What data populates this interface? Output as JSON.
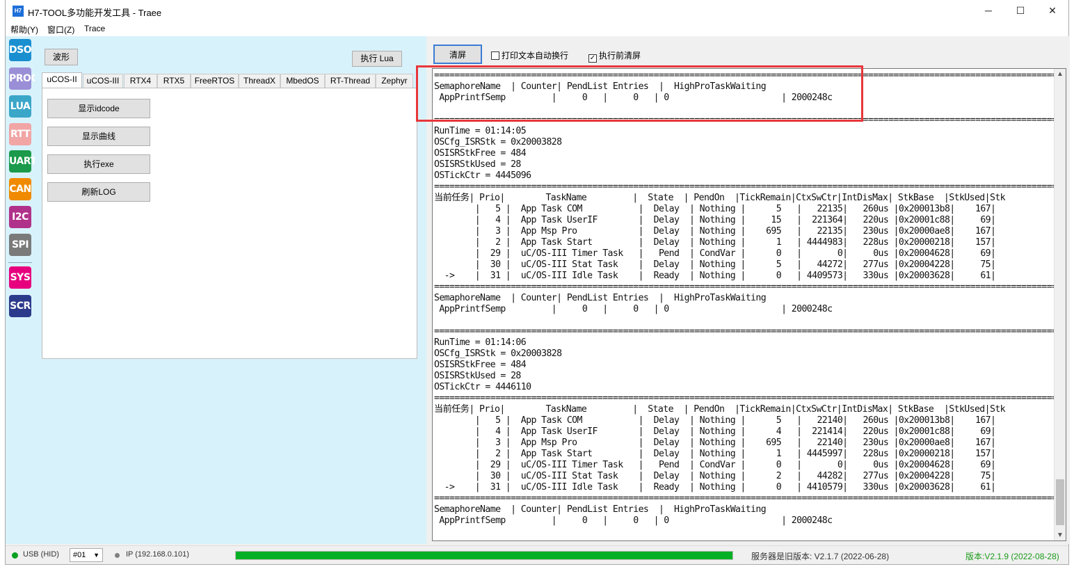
{
  "window": {
    "icon_text": "H7",
    "title": "H7-TOOL多功能开发工具 - Traee",
    "minimize": "─",
    "maximize": "☐",
    "close": "✕"
  },
  "menu": [
    "帮助(Y)",
    "窗口(Z)",
    "Trace"
  ],
  "sidebar": [
    {
      "label": "DSO",
      "color": "#1a8fd0"
    },
    {
      "label": "PROG",
      "color": "#9a8fd6"
    },
    {
      "label": "LUA",
      "color": "#3aa6c8"
    },
    {
      "label": "RTT",
      "color": "#f1a5a5"
    },
    {
      "label": "UART",
      "color": "#1a9a4a"
    },
    {
      "label": "CAN",
      "color": "#f08a00"
    },
    {
      "label": "I2C",
      "color": "#b0318a"
    },
    {
      "label": "SPI",
      "color": "#7a7a7a"
    },
    {
      "label": "SYS",
      "color": "#e6007e"
    },
    {
      "label": "SCR",
      "color": "#2c3a8c"
    }
  ],
  "left_panel": {
    "waveform_button": "波形",
    "run_lua_button": "执行 Lua",
    "tabs": [
      "uCOS-II",
      "uCOS-III",
      "RTX4",
      "RTX5",
      "FreeRTOS",
      "ThreadX",
      "MbedOS",
      "RT-Thread",
      "Zephyr"
    ],
    "active_tab": "uCOS-II",
    "actions": [
      "显示idcode",
      "显示曲线",
      "执行exe",
      "刷新LOG"
    ]
  },
  "right_panel": {
    "clear_button": "清屏",
    "wrap_checkbox": {
      "label": "打印文本自动换行",
      "checked": false
    },
    "clear_before_checkbox": {
      "label": "执行前清屏",
      "checked": true
    },
    "console_lines": [
      "=============================================================================================================================",
      "SemaphoreName  | Counter| PendList Entries  |  HighProTaskWaiting",
      " AppPrintfSemp         |     0   |     0   | 0                      | 2000248c",
      "",
      "=============================================================================================================================",
      "RunTime = 01:14:05",
      "OSCfg_ISRStk = 0x20003828",
      "OSISRStkFree = 484",
      "OSISRStkUsed = 28",
      "OSTickCtr = 4445096",
      "=============================================================================================================================",
      "当前任务| Prio|        TaskName         |  State  | PendOn  |TickRemain|CtxSwCtr|IntDisMax| StkBase  |StkUsed|Stk",
      "        |   5 |  App Task COM           |  Delay  | Nothing |      5   |   22135|   260us |0x200013b8|    167|",
      "        |   4 |  App Task UserIF        |  Delay  | Nothing |     15   |  221364|   220us |0x20001c88|     69|",
      "        |   3 |  App Msp Pro            |  Delay  | Nothing |    695   |   22135|   230us |0x20000ae8|    167|",
      "        |   2 |  App Task Start         |  Delay  | Nothing |      1   | 4444983|   228us |0x20000218|    157|",
      "        |  29 |  uC/OS-III Timer Task   |   Pend  | CondVar |      0   |       0|     0us |0x20004628|     69|",
      "        |  30 |  uC/OS-III Stat Task    |  Delay  | Nothing |      5   |   44272|   277us |0x20004228|     75|",
      "  ->    |  31 |  uC/OS-III Idle Task    |  Ready  | Nothing |      0   | 4409573|   330us |0x20003628|     61|",
      "=============================================================================================================================",
      "SemaphoreName  | Counter| PendList Entries  |  HighProTaskWaiting",
      " AppPrintfSemp         |     0   |     0   | 0                      | 2000248c",
      "",
      "=============================================================================================================================",
      "RunTime = 01:14:06",
      "OSCfg_ISRStk = 0x20003828",
      "OSISRStkFree = 484",
      "OSISRStkUsed = 28",
      "OSTickCtr = 4446110",
      "=============================================================================================================================",
      "当前任务| Prio|        TaskName         |  State  | PendOn  |TickRemain|CtxSwCtr|IntDisMax| StkBase  |StkUsed|Stk",
      "        |   5 |  App Task COM           |  Delay  | Nothing |      5   |   22140|   260us |0x200013b8|    167|",
      "        |   4 |  App Task UserIF        |  Delay  | Nothing |      4   |  221414|   220us |0x20001c88|     69|",
      "        |   3 |  App Msp Pro            |  Delay  | Nothing |    695   |   22140|   230us |0x20000ae8|    167|",
      "        |   2 |  App Task Start         |  Delay  | Nothing |      1   | 4445997|   228us |0x20000218|    157|",
      "        |  29 |  uC/OS-III Timer Task   |   Pend  | CondVar |      0   |       0|     0us |0x20004628|     69|",
      "        |  30 |  uC/OS-III Stat Task    |  Delay  | Nothing |      2   |   44282|   277us |0x20004228|     75|",
      "  ->    |  31 |  uC/OS-III Idle Task    |  Ready  | Nothing |      0   | 4410579|   330us |0x20003628|     61|",
      "=============================================================================================================================",
      "SemaphoreName  | Counter| PendList Entries  |  HighProTaskWaiting",
      " AppPrintfSemp         |     0   |     0   | 0                      | 2000248c"
    ]
  },
  "status": {
    "usb": "USB (HID)",
    "usb_color": "#06a020",
    "device": "#01",
    "ip": "IP (192.168.0.101)",
    "ip_color": "#808080",
    "progress_percent": 100,
    "server_version": "服务器是旧版本: V2.1.7 (2022-06-28)",
    "version": "版本:V2.1.9 (2022-08-28)",
    "version_color": "#1a9a1a"
  }
}
